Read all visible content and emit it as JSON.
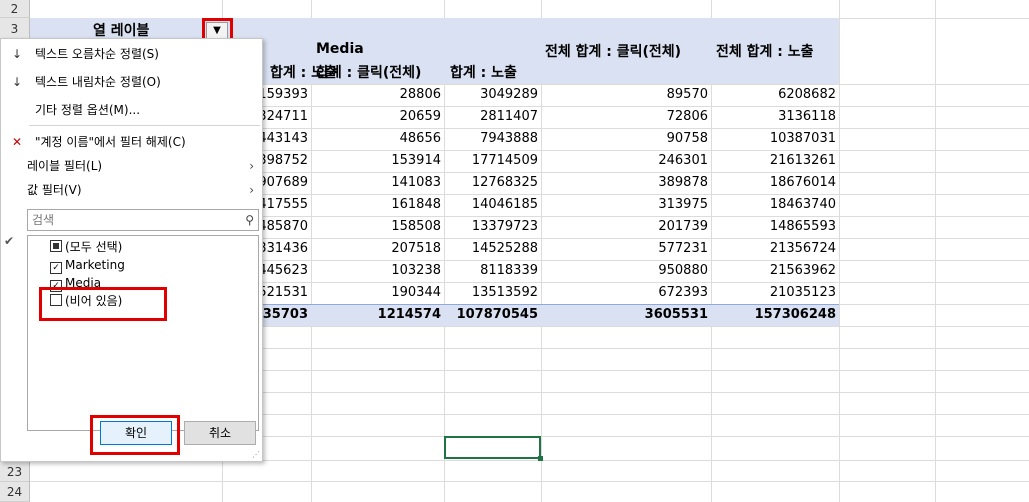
{
  "rows": {
    "top": "2",
    "r3": "3",
    "r23": "23",
    "r24": "24"
  },
  "column_label": "열 레이블",
  "headers": {
    "col_c": "합계 : 노출",
    "media_group": "Media",
    "media_click": "합계 : 클릭(전체)",
    "media_impr": "합계 : 노출",
    "total_click": "전체 합계 : 클릭(전체)",
    "total_impr": "전체 합계 : 노출"
  },
  "data_rows": [
    [
      "159393",
      "28806",
      "3049289",
      "89570",
      "6208682"
    ],
    [
      "324711",
      "20659",
      "2811407",
      "72806",
      "3136118"
    ],
    [
      "443143",
      "48656",
      "7943888",
      "90758",
      "10387031"
    ],
    [
      "398752",
      "153914",
      "17714509",
      "246301",
      "21613261"
    ],
    [
      "907689",
      "141083",
      "12768325",
      "389878",
      "18676014"
    ],
    [
      "417555",
      "161848",
      "14046185",
      "313975",
      "18463740"
    ],
    [
      "485870",
      "158508",
      "13379723",
      "201739",
      "14865593"
    ],
    [
      "331436",
      "207518",
      "14525288",
      "577231",
      "21356724"
    ],
    [
      "445623",
      "103238",
      "8118339",
      "950880",
      "21563962"
    ],
    [
      "521531",
      "190344",
      "13513592",
      "672393",
      "21035123"
    ]
  ],
  "total_row": [
    "35703",
    "1214574",
    "107870545",
    "3605531",
    "157306248"
  ],
  "filter_menu": {
    "sort_asc": "텍스트 오름차순 정렬(S)",
    "sort_desc": "텍스트 내림차순 정렬(O)",
    "sort_more": "기타 정렬 옵션(M)...",
    "clear_filter": "\"계정 이름\"에서 필터 해제(C)",
    "label_filter": "레이블 필터(L)",
    "value_filter": "값 필터(V)",
    "search_placeholder": "검색",
    "items": [
      {
        "label": "(모두 선택)",
        "state": "partial"
      },
      {
        "label": "Marketing",
        "state": "checked"
      },
      {
        "label": "Media",
        "state": "checked"
      },
      {
        "label": "(비어 있음)",
        "state": "unchecked"
      }
    ],
    "ok": "확인",
    "cancel": "취소"
  },
  "icons": {
    "filter_dropdown": "filter-funnel-icon",
    "sort_asc": "sort-ascending-icon",
    "sort_desc": "sort-descending-icon",
    "clear_filter": "clear-filter-icon",
    "search": "search-icon",
    "submenu": "chevron-right-icon"
  },
  "colors": {
    "pivot_header": "#d9e1f2",
    "highlight": "#e00000",
    "selection": "#217346"
  }
}
